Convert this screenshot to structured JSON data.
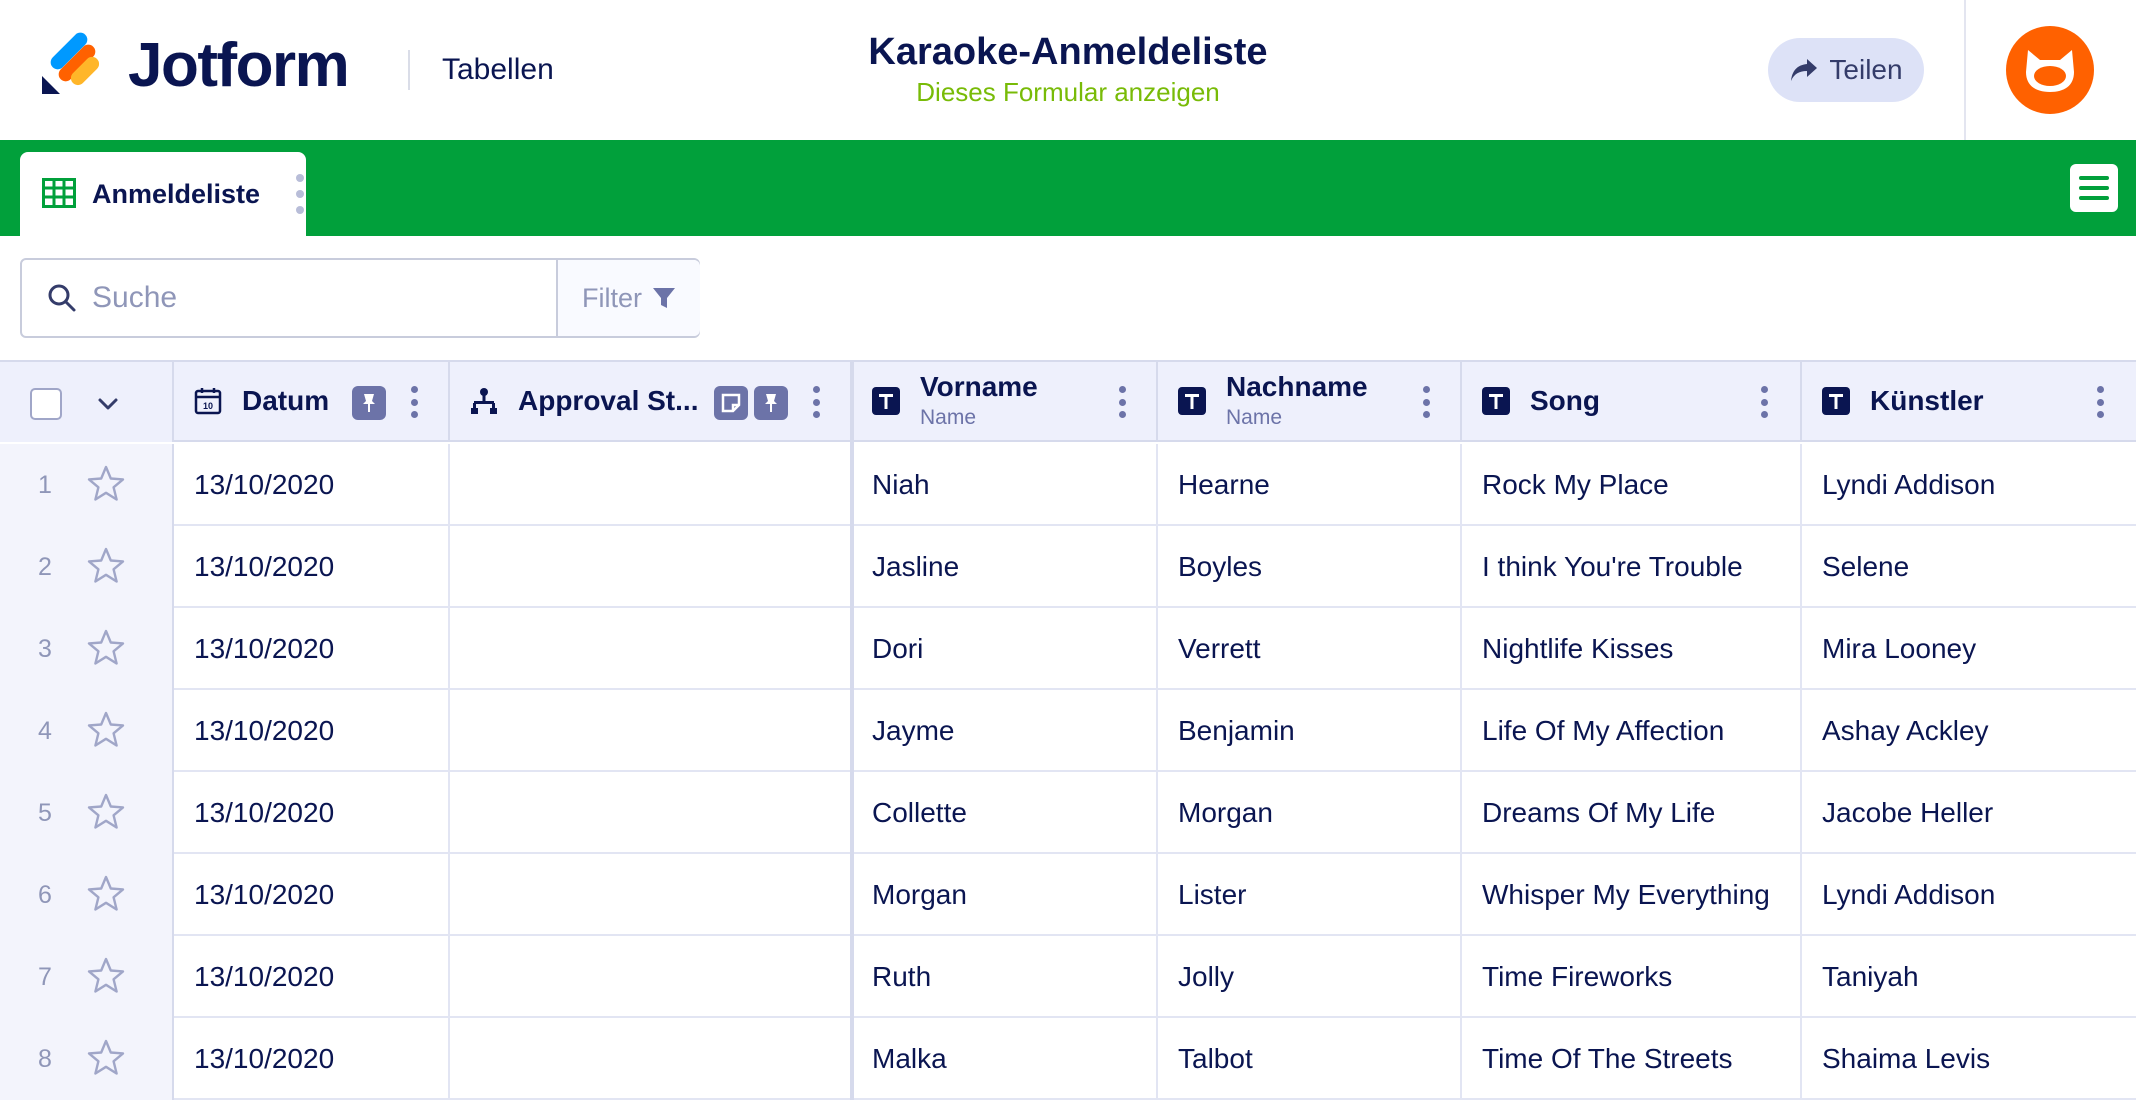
{
  "header": {
    "brand": "Jotform",
    "section": "Tabellen",
    "form_title": "Karaoke-Anmeldeliste",
    "form_link": "Dieses Formular anzeigen",
    "share_label": "Teilen",
    "brand_color": "#0a1551",
    "accent_green": "#78bb07"
  },
  "tabbar": {
    "tab_label": "Anmeldeliste",
    "color": "#01a03b"
  },
  "search": {
    "placeholder": "Suche",
    "filter_label": "Filter"
  },
  "columns": [
    {
      "label": "Datum",
      "sub": "",
      "icon": "calendar-icon"
    },
    {
      "label": "Approval St...",
      "sub": "",
      "icon": "approval-flow-icon"
    },
    {
      "label": "Vorname",
      "sub": "Name",
      "icon": "text-type-icon"
    },
    {
      "label": "Nachname",
      "sub": "Name",
      "icon": "text-type-icon"
    },
    {
      "label": "Song",
      "sub": "",
      "icon": "text-type-icon"
    },
    {
      "label": "Künstler",
      "sub": "",
      "icon": "text-type-icon"
    }
  ],
  "rows": [
    {
      "num": "1",
      "datum": "13/10/2020",
      "approval": "",
      "vorname": "Niah",
      "nachname": "Hearne",
      "song": "Rock My Place",
      "kuenstler": "Lyndi Addison"
    },
    {
      "num": "2",
      "datum": "13/10/2020",
      "approval": "",
      "vorname": "Jasline",
      "nachname": "Boyles",
      "song": "I think You're Trouble",
      "kuenstler": "Selene"
    },
    {
      "num": "3",
      "datum": "13/10/2020",
      "approval": "",
      "vorname": "Dori",
      "nachname": "Verrett",
      "song": "Nightlife Kisses",
      "kuenstler": "Mira Looney"
    },
    {
      "num": "4",
      "datum": "13/10/2020",
      "approval": "",
      "vorname": "Jayme",
      "nachname": "Benjamin",
      "song": "Life Of My Affection",
      "kuenstler": "Ashay Ackley"
    },
    {
      "num": "5",
      "datum": "13/10/2020",
      "approval": "",
      "vorname": "Collette",
      "nachname": "Morgan",
      "song": "Dreams Of My Life",
      "kuenstler": "Jacobe Heller"
    },
    {
      "num": "6",
      "datum": "13/10/2020",
      "approval": "",
      "vorname": "Morgan",
      "nachname": "Lister",
      "song": "Whisper My Everything",
      "kuenstler": "Lyndi Addison"
    },
    {
      "num": "7",
      "datum": "13/10/2020",
      "approval": "",
      "vorname": "Ruth",
      "nachname": "Jolly",
      "song": "Time Fireworks",
      "kuenstler": "Taniyah"
    },
    {
      "num": "8",
      "datum": "13/10/2020",
      "approval": "",
      "vorname": "Malka",
      "nachname": "Talbot",
      "song": "Time Of The Streets",
      "kuenstler": "Shaima Levis"
    }
  ]
}
